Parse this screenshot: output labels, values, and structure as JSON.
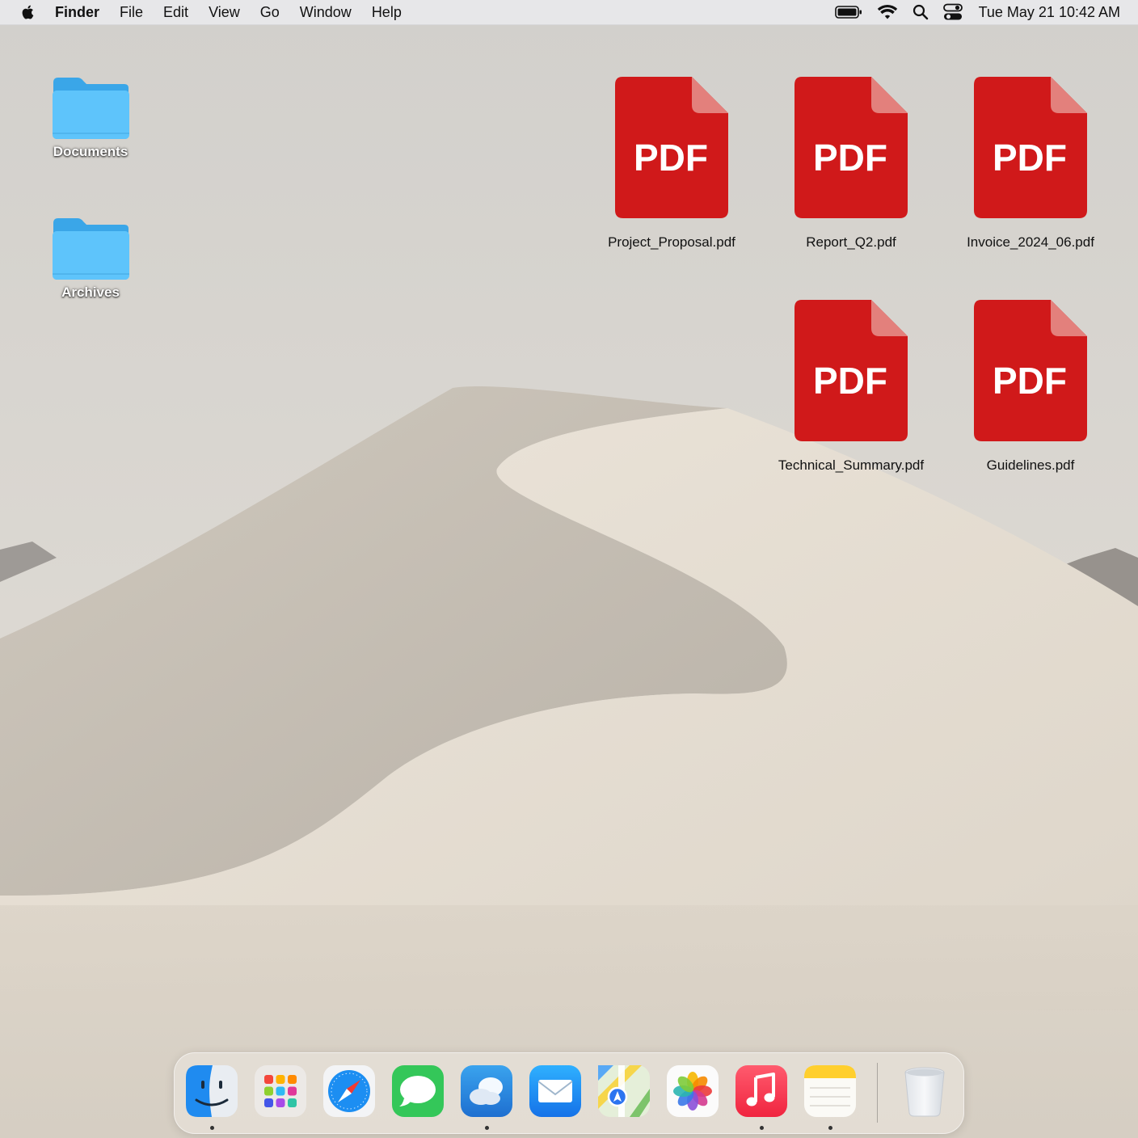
{
  "menubar": {
    "app_name": "Finder",
    "menus": [
      "File",
      "Edit",
      "View",
      "Go",
      "Window",
      "Help"
    ],
    "status_icons": [
      "battery-icon",
      "wifi-icon",
      "spotlight-search-icon",
      "control-center-icon"
    ],
    "clock": "Tue May 21  10:42 AM"
  },
  "desktop": {
    "folders": [
      {
        "label": "Documents"
      },
      {
        "label": "Archives"
      }
    ],
    "files": [
      {
        "label": "Project_Proposal.pdf",
        "badge": "PDF"
      },
      {
        "label": "Report_Q2.pdf",
        "badge": "PDF"
      },
      {
        "label": "Invoice_2024_06.pdf",
        "badge": "PDF"
      },
      {
        "label": "Technical_Summary.pdf",
        "badge": "PDF"
      },
      {
        "label": "Guidelines.pdf",
        "badge": "PDF"
      }
    ]
  },
  "dock": {
    "apps": [
      {
        "icon": "finder-icon",
        "running": true
      },
      {
        "icon": "launchpad-icon",
        "running": false
      },
      {
        "icon": "safari-icon",
        "running": false
      },
      {
        "icon": "messages-icon",
        "running": false
      },
      {
        "icon": "weather-icon",
        "running": true
      },
      {
        "icon": "mail-icon",
        "running": false
      },
      {
        "icon": "maps-icon",
        "running": false
      },
      {
        "icon": "photos-icon",
        "running": false
      },
      {
        "icon": "music-icon",
        "running": true
      },
      {
        "icon": "notes-icon",
        "running": true
      }
    ],
    "trash": {
      "icon": "trash-icon"
    }
  },
  "colors": {
    "pdf_red": "#d0191a",
    "folder_blue": "#5ec4fb",
    "menubar_bg": "#e8e8ec"
  }
}
